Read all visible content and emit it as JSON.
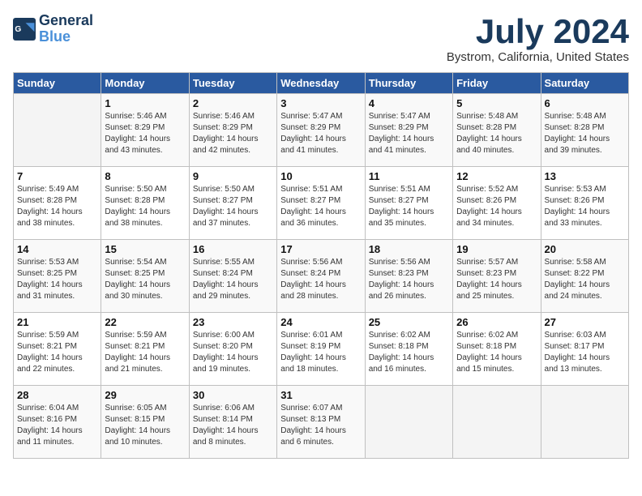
{
  "header": {
    "logo_line1": "General",
    "logo_line2": "Blue",
    "month_year": "July 2024",
    "location": "Bystrom, California, United States"
  },
  "weekdays": [
    "Sunday",
    "Monday",
    "Tuesday",
    "Wednesday",
    "Thursday",
    "Friday",
    "Saturday"
  ],
  "weeks": [
    [
      {
        "day": "",
        "sunrise": "",
        "sunset": "",
        "daylight": ""
      },
      {
        "day": "1",
        "sunrise": "Sunrise: 5:46 AM",
        "sunset": "Sunset: 8:29 PM",
        "daylight": "Daylight: 14 hours and 43 minutes."
      },
      {
        "day": "2",
        "sunrise": "Sunrise: 5:46 AM",
        "sunset": "Sunset: 8:29 PM",
        "daylight": "Daylight: 14 hours and 42 minutes."
      },
      {
        "day": "3",
        "sunrise": "Sunrise: 5:47 AM",
        "sunset": "Sunset: 8:29 PM",
        "daylight": "Daylight: 14 hours and 41 minutes."
      },
      {
        "day": "4",
        "sunrise": "Sunrise: 5:47 AM",
        "sunset": "Sunset: 8:29 PM",
        "daylight": "Daylight: 14 hours and 41 minutes."
      },
      {
        "day": "5",
        "sunrise": "Sunrise: 5:48 AM",
        "sunset": "Sunset: 8:28 PM",
        "daylight": "Daylight: 14 hours and 40 minutes."
      },
      {
        "day": "6",
        "sunrise": "Sunrise: 5:48 AM",
        "sunset": "Sunset: 8:28 PM",
        "daylight": "Daylight: 14 hours and 39 minutes."
      }
    ],
    [
      {
        "day": "7",
        "sunrise": "Sunrise: 5:49 AM",
        "sunset": "Sunset: 8:28 PM",
        "daylight": "Daylight: 14 hours and 38 minutes."
      },
      {
        "day": "8",
        "sunrise": "Sunrise: 5:50 AM",
        "sunset": "Sunset: 8:28 PM",
        "daylight": "Daylight: 14 hours and 38 minutes."
      },
      {
        "day": "9",
        "sunrise": "Sunrise: 5:50 AM",
        "sunset": "Sunset: 8:27 PM",
        "daylight": "Daylight: 14 hours and 37 minutes."
      },
      {
        "day": "10",
        "sunrise": "Sunrise: 5:51 AM",
        "sunset": "Sunset: 8:27 PM",
        "daylight": "Daylight: 14 hours and 36 minutes."
      },
      {
        "day": "11",
        "sunrise": "Sunrise: 5:51 AM",
        "sunset": "Sunset: 8:27 PM",
        "daylight": "Daylight: 14 hours and 35 minutes."
      },
      {
        "day": "12",
        "sunrise": "Sunrise: 5:52 AM",
        "sunset": "Sunset: 8:26 PM",
        "daylight": "Daylight: 14 hours and 34 minutes."
      },
      {
        "day": "13",
        "sunrise": "Sunrise: 5:53 AM",
        "sunset": "Sunset: 8:26 PM",
        "daylight": "Daylight: 14 hours and 33 minutes."
      }
    ],
    [
      {
        "day": "14",
        "sunrise": "Sunrise: 5:53 AM",
        "sunset": "Sunset: 8:25 PM",
        "daylight": "Daylight: 14 hours and 31 minutes."
      },
      {
        "day": "15",
        "sunrise": "Sunrise: 5:54 AM",
        "sunset": "Sunset: 8:25 PM",
        "daylight": "Daylight: 14 hours and 30 minutes."
      },
      {
        "day": "16",
        "sunrise": "Sunrise: 5:55 AM",
        "sunset": "Sunset: 8:24 PM",
        "daylight": "Daylight: 14 hours and 29 minutes."
      },
      {
        "day": "17",
        "sunrise": "Sunrise: 5:56 AM",
        "sunset": "Sunset: 8:24 PM",
        "daylight": "Daylight: 14 hours and 28 minutes."
      },
      {
        "day": "18",
        "sunrise": "Sunrise: 5:56 AM",
        "sunset": "Sunset: 8:23 PM",
        "daylight": "Daylight: 14 hours and 26 minutes."
      },
      {
        "day": "19",
        "sunrise": "Sunrise: 5:57 AM",
        "sunset": "Sunset: 8:23 PM",
        "daylight": "Daylight: 14 hours and 25 minutes."
      },
      {
        "day": "20",
        "sunrise": "Sunrise: 5:58 AM",
        "sunset": "Sunset: 8:22 PM",
        "daylight": "Daylight: 14 hours and 24 minutes."
      }
    ],
    [
      {
        "day": "21",
        "sunrise": "Sunrise: 5:59 AM",
        "sunset": "Sunset: 8:21 PM",
        "daylight": "Daylight: 14 hours and 22 minutes."
      },
      {
        "day": "22",
        "sunrise": "Sunrise: 5:59 AM",
        "sunset": "Sunset: 8:21 PM",
        "daylight": "Daylight: 14 hours and 21 minutes."
      },
      {
        "day": "23",
        "sunrise": "Sunrise: 6:00 AM",
        "sunset": "Sunset: 8:20 PM",
        "daylight": "Daylight: 14 hours and 19 minutes."
      },
      {
        "day": "24",
        "sunrise": "Sunrise: 6:01 AM",
        "sunset": "Sunset: 8:19 PM",
        "daylight": "Daylight: 14 hours and 18 minutes."
      },
      {
        "day": "25",
        "sunrise": "Sunrise: 6:02 AM",
        "sunset": "Sunset: 8:18 PM",
        "daylight": "Daylight: 14 hours and 16 minutes."
      },
      {
        "day": "26",
        "sunrise": "Sunrise: 6:02 AM",
        "sunset": "Sunset: 8:18 PM",
        "daylight": "Daylight: 14 hours and 15 minutes."
      },
      {
        "day": "27",
        "sunrise": "Sunrise: 6:03 AM",
        "sunset": "Sunset: 8:17 PM",
        "daylight": "Daylight: 14 hours and 13 minutes."
      }
    ],
    [
      {
        "day": "28",
        "sunrise": "Sunrise: 6:04 AM",
        "sunset": "Sunset: 8:16 PM",
        "daylight": "Daylight: 14 hours and 11 minutes."
      },
      {
        "day": "29",
        "sunrise": "Sunrise: 6:05 AM",
        "sunset": "Sunset: 8:15 PM",
        "daylight": "Daylight: 14 hours and 10 minutes."
      },
      {
        "day": "30",
        "sunrise": "Sunrise: 6:06 AM",
        "sunset": "Sunset: 8:14 PM",
        "daylight": "Daylight: 14 hours and 8 minutes."
      },
      {
        "day": "31",
        "sunrise": "Sunrise: 6:07 AM",
        "sunset": "Sunset: 8:13 PM",
        "daylight": "Daylight: 14 hours and 6 minutes."
      },
      {
        "day": "",
        "sunrise": "",
        "sunset": "",
        "daylight": ""
      },
      {
        "day": "",
        "sunrise": "",
        "sunset": "",
        "daylight": ""
      },
      {
        "day": "",
        "sunrise": "",
        "sunset": "",
        "daylight": ""
      }
    ]
  ]
}
